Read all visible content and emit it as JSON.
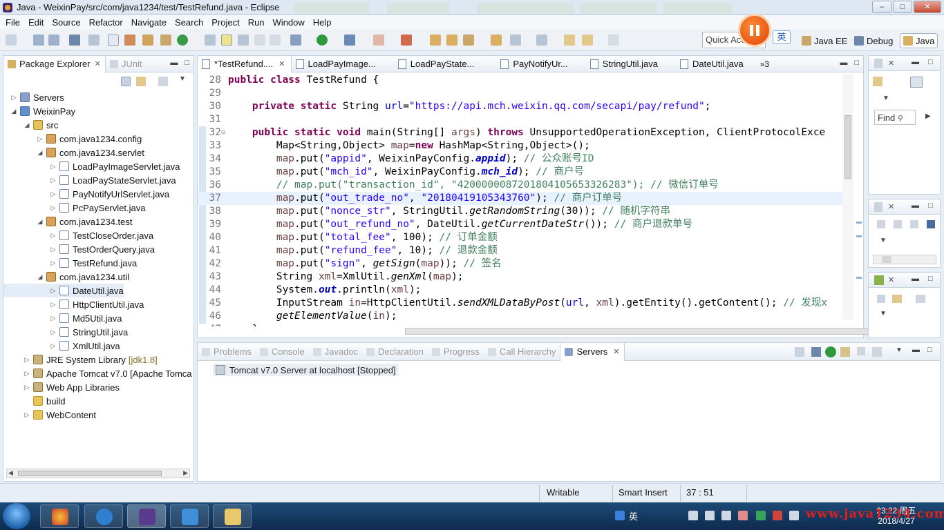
{
  "window": {
    "title": "Java - WeixinPay/src/com/java1234/test/TestRefund.java - Eclipse"
  },
  "menu": [
    "File",
    "Edit",
    "Source",
    "Refactor",
    "Navigate",
    "Search",
    "Project",
    "Run",
    "Window",
    "Help"
  ],
  "toolbar": {
    "quick_access": "Quick Acc",
    "ime_label": "英"
  },
  "perspectives": [
    {
      "label": "Java EE",
      "active": false
    },
    {
      "label": "Debug",
      "active": false
    },
    {
      "label": "Java",
      "active": true
    }
  ],
  "package_explorer": {
    "tabs": [
      {
        "label": "Package Explorer",
        "active": true
      },
      {
        "label": "JUnit",
        "active": false
      }
    ],
    "tree": [
      {
        "label": "Servers",
        "depth": 0,
        "twisty": "closed",
        "icon": "folder-server-icon"
      },
      {
        "label": "WeixinPay",
        "depth": 0,
        "twisty": "open",
        "icon": "project-icon"
      },
      {
        "label": "src",
        "depth": 1,
        "twisty": "open",
        "icon": "source-folder-icon"
      },
      {
        "label": "com.java1234.config",
        "depth": 2,
        "twisty": "closed",
        "icon": "package-icon"
      },
      {
        "label": "com.java1234.servlet",
        "depth": 2,
        "twisty": "open",
        "icon": "package-icon"
      },
      {
        "label": "LoadPayImageServlet.java",
        "depth": 3,
        "twisty": "closed",
        "icon": "java-file-icon"
      },
      {
        "label": "LoadPayStateServlet.java",
        "depth": 3,
        "twisty": "closed",
        "icon": "java-file-icon"
      },
      {
        "label": "PayNotifyUrlServlet.java",
        "depth": 3,
        "twisty": "closed",
        "icon": "java-file-icon"
      },
      {
        "label": "PcPayServlet.java",
        "depth": 3,
        "twisty": "closed",
        "icon": "java-file-icon"
      },
      {
        "label": "com.java1234.test",
        "depth": 2,
        "twisty": "open",
        "icon": "package-icon"
      },
      {
        "label": "TestCloseOrder.java",
        "depth": 3,
        "twisty": "closed",
        "icon": "java-file-icon"
      },
      {
        "label": "TestOrderQuery.java",
        "depth": 3,
        "twisty": "closed",
        "icon": "java-file-icon"
      },
      {
        "label": "TestRefund.java",
        "depth": 3,
        "twisty": "closed",
        "icon": "java-file-icon"
      },
      {
        "label": "com.java1234.util",
        "depth": 2,
        "twisty": "open",
        "icon": "package-icon"
      },
      {
        "label": "DateUtil.java",
        "depth": 3,
        "twisty": "closed",
        "icon": "java-file-icon",
        "selected": true
      },
      {
        "label": "HttpClientUtil.java",
        "depth": 3,
        "twisty": "closed",
        "icon": "java-file-icon"
      },
      {
        "label": "Md5Util.java",
        "depth": 3,
        "twisty": "closed",
        "icon": "java-file-icon"
      },
      {
        "label": "StringUtil.java",
        "depth": 3,
        "twisty": "closed",
        "icon": "java-file-icon"
      },
      {
        "label": "XmlUtil.java",
        "depth": 3,
        "twisty": "closed",
        "icon": "java-file-icon"
      },
      {
        "label": "JRE System Library",
        "suffix": "[jdk1.8]",
        "depth": 1,
        "twisty": "closed",
        "icon": "library-icon"
      },
      {
        "label": "Apache Tomcat v7.0 [Apache Tomca",
        "depth": 1,
        "twisty": "closed",
        "icon": "library-icon"
      },
      {
        "label": "Web App Libraries",
        "depth": 1,
        "twisty": "closed",
        "icon": "library-icon"
      },
      {
        "label": "build",
        "depth": 1,
        "twisty": "none",
        "icon": "folder-icon"
      },
      {
        "label": "WebContent",
        "depth": 1,
        "twisty": "closed",
        "icon": "folder-icon"
      }
    ]
  },
  "editor": {
    "tabs": [
      {
        "label": "*TestRefund....",
        "active": true
      },
      {
        "label": "LoadPayImage...",
        "active": false
      },
      {
        "label": "LoadPayState...",
        "active": false
      },
      {
        "label": "PayNotifyUr...",
        "active": false
      },
      {
        "label": "StringUtil.java",
        "active": false
      },
      {
        "label": "DateUtil.java",
        "active": false
      }
    ],
    "overflow_count": "»3",
    "current_line": 37,
    "lines": [
      {
        "n": "28",
        "t": [
          [
            "k",
            "public class "
          ],
          [
            "",
            "TestRefund {"
          ]
        ]
      },
      {
        "n": "29",
        "t": []
      },
      {
        "n": "30",
        "t": [
          [
            "",
            "    "
          ],
          [
            "k",
            "private static "
          ],
          [
            "",
            "String "
          ],
          [
            "f",
            "url"
          ],
          [
            "",
            "="
          ],
          [
            "s",
            "\"https://api.mch.weixin.qq.com/secapi/pay/refund\""
          ],
          [
            "",
            ";"
          ]
        ]
      },
      {
        "n": "31",
        "t": []
      },
      {
        "n": "32",
        "fold": true,
        "t": [
          [
            "",
            "    "
          ],
          [
            "k",
            "public static void "
          ],
          [
            "",
            "main(String[] "
          ],
          [
            "v",
            "args"
          ],
          [
            "",
            ") "
          ],
          [
            "k",
            "throws "
          ],
          [
            "",
            "UnsupportedOperationException, ClientProtocolExce"
          ]
        ]
      },
      {
        "n": "33",
        "t": [
          [
            "",
            "        Map<String,Object> "
          ],
          [
            "v",
            "map"
          ],
          [
            "",
            "="
          ],
          [
            "k",
            "new "
          ],
          [
            "",
            "HashMap<String,Object>();"
          ]
        ]
      },
      {
        "n": "34",
        "t": [
          [
            "",
            "        "
          ],
          [
            "v",
            "map"
          ],
          [
            "",
            ".put("
          ],
          [
            "s",
            "\"appid\""
          ],
          [
            "",
            ", WeixinPayConfig."
          ],
          [
            "fi",
            "appid"
          ],
          [
            "",
            "); "
          ],
          [
            "c",
            "// 公众账号ID"
          ]
        ]
      },
      {
        "n": "35",
        "t": [
          [
            "",
            "        "
          ],
          [
            "v",
            "map"
          ],
          [
            "",
            ".put("
          ],
          [
            "s",
            "\"mch_id\""
          ],
          [
            "",
            ", WeixinPayConfig."
          ],
          [
            "fi",
            "mch_id"
          ],
          [
            "",
            "); "
          ],
          [
            "c",
            "// 商户号"
          ]
        ]
      },
      {
        "n": "36",
        "t": [
          [
            "",
            "        "
          ],
          [
            "c",
            "// map.put(\"transaction_id\", \"4200000087201804105653326283\"); // 微信订单号"
          ]
        ]
      },
      {
        "n": "37",
        "t": [
          [
            "",
            "        "
          ],
          [
            "v",
            "map"
          ],
          [
            "",
            ".put("
          ],
          [
            "s",
            "\"out_trade_no\""
          ],
          [
            "",
            ", "
          ],
          [
            "s",
            "\"20180419105343760\""
          ],
          [
            "",
            "); "
          ],
          [
            "c",
            "// 商户订单号"
          ]
        ]
      },
      {
        "n": "38",
        "t": [
          [
            "",
            "        "
          ],
          [
            "v",
            "map"
          ],
          [
            "",
            ".put("
          ],
          [
            "s",
            "\"nonce_str\""
          ],
          [
            "",
            ", StringUtil."
          ],
          [
            "st",
            "getRandomString"
          ],
          [
            "",
            "(30)); "
          ],
          [
            "c",
            "// 随机字符串"
          ]
        ]
      },
      {
        "n": "39",
        "t": [
          [
            "",
            "        "
          ],
          [
            "v",
            "map"
          ],
          [
            "",
            ".put("
          ],
          [
            "s",
            "\"out_refund_no\""
          ],
          [
            "",
            ", DateUtil."
          ],
          [
            "st",
            "getCurrentDateStr"
          ],
          [
            "",
            "()); "
          ],
          [
            "c",
            "// 商户退款单号"
          ]
        ]
      },
      {
        "n": "40",
        "t": [
          [
            "",
            "        "
          ],
          [
            "v",
            "map"
          ],
          [
            "",
            ".put("
          ],
          [
            "s",
            "\"total_fee\""
          ],
          [
            "",
            ", 100); "
          ],
          [
            "c",
            "// 订单金额"
          ]
        ]
      },
      {
        "n": "41",
        "t": [
          [
            "",
            "        "
          ],
          [
            "v",
            "map"
          ],
          [
            "",
            ".put("
          ],
          [
            "s",
            "\"refund_fee\""
          ],
          [
            "",
            ", 10); "
          ],
          [
            "c",
            "// 退款金额"
          ]
        ]
      },
      {
        "n": "42",
        "t": [
          [
            "",
            "        "
          ],
          [
            "v",
            "map"
          ],
          [
            "",
            ".put("
          ],
          [
            "s",
            "\"sign\""
          ],
          [
            "",
            ", "
          ],
          [
            "st",
            "getSign"
          ],
          [
            "",
            "("
          ],
          [
            "v",
            "map"
          ],
          [
            "",
            "));"
          ],
          [
            "c",
            " // 签名"
          ]
        ]
      },
      {
        "n": "43",
        "t": [
          [
            "",
            "        String "
          ],
          [
            "v",
            "xml"
          ],
          [
            "",
            "=XmlUtil."
          ],
          [
            "st",
            "genXml"
          ],
          [
            "",
            "("
          ],
          [
            "v",
            "map"
          ],
          [
            "",
            ");"
          ]
        ]
      },
      {
        "n": "44",
        "t": [
          [
            "",
            "        System."
          ],
          [
            "fi",
            "out"
          ],
          [
            "",
            ".println("
          ],
          [
            "v",
            "xml"
          ],
          [
            "",
            ");"
          ]
        ]
      },
      {
        "n": "45",
        "t": [
          [
            "",
            "        InputStream "
          ],
          [
            "v",
            "in"
          ],
          [
            "",
            "=HttpClientUtil."
          ],
          [
            "st",
            "sendXMLDataByPost"
          ],
          [
            "",
            "("
          ],
          [
            "f",
            "url"
          ],
          [
            "",
            ", "
          ],
          [
            "v",
            "xml"
          ],
          [
            "",
            ").getEntity().getContent(); "
          ],
          [
            "c",
            "// 发现x"
          ]
        ]
      },
      {
        "n": "46",
        "t": [
          [
            "",
            "        "
          ],
          [
            "st",
            "getElementValue"
          ],
          [
            "",
            "("
          ],
          [
            "v",
            "in"
          ],
          [
            "",
            ");"
          ]
        ]
      },
      {
        "n": "47",
        "t": [
          [
            "",
            "    }"
          ]
        ]
      }
    ]
  },
  "right_views": {
    "find_placeholder": "Find"
  },
  "bottom_panel": {
    "tabs": [
      {
        "label": "Problems",
        "active": false
      },
      {
        "label": "Console",
        "active": false
      },
      {
        "label": "Javadoc",
        "active": false
      },
      {
        "label": "Declaration",
        "active": false
      },
      {
        "label": "Progress",
        "active": false
      },
      {
        "label": "Call Hierarchy",
        "active": false
      },
      {
        "label": "Servers",
        "active": true
      }
    ],
    "server_entry": "Tomcat v7.0 Server at localhost  [Stopped]"
  },
  "status_bar": {
    "writable": "Writable",
    "insert_mode": "Smart Insert",
    "position": "37 : 51"
  },
  "taskbar": {
    "ime": "英",
    "time": "23:22 周五",
    "date": "2018/4/27"
  },
  "watermark": "www.java1234.com",
  "colors": {
    "keyword": "#7f0055",
    "string": "#2a00ff",
    "comment": "#3f7f5f",
    "field": "#0000c0",
    "record_button": "#e04400"
  }
}
